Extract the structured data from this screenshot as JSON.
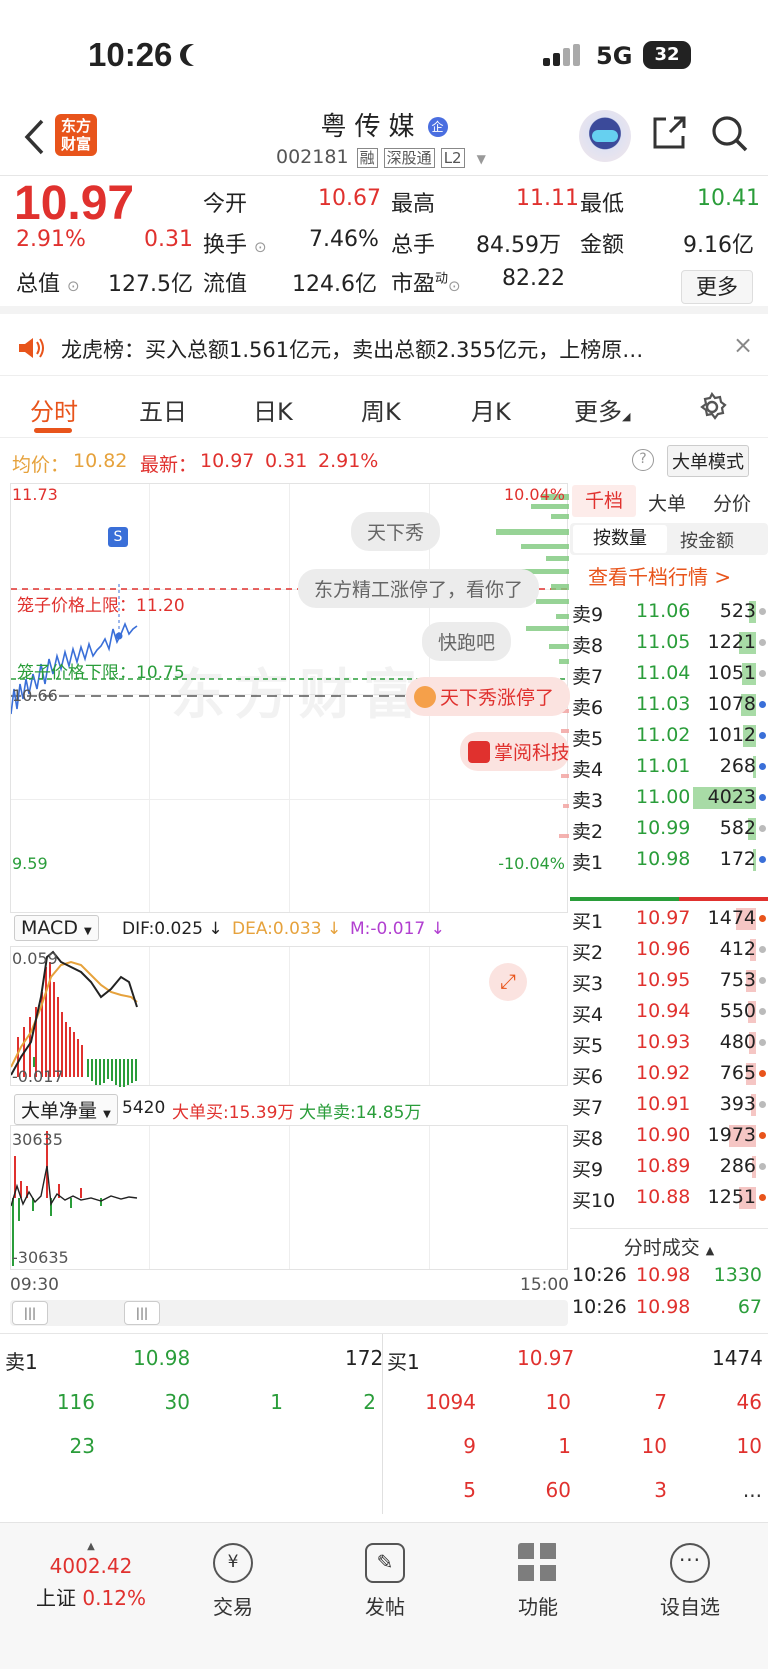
{
  "status_bar": {
    "time": "10:26",
    "network": "5G",
    "battery": "32"
  },
  "header": {
    "logo_text": "东方财富",
    "title": "粤传媒",
    "enterprise_badge": "企",
    "code": "002181",
    "tags": [
      "融",
      "深股通",
      "L2"
    ]
  },
  "quote": {
    "price": "10.97",
    "change_pct": "2.91%",
    "change": "0.31",
    "open_label": "今开",
    "open": "10.67",
    "high_label": "最高",
    "high": "11.11",
    "low_label": "最低",
    "low": "10.41",
    "turnover_label": "换手",
    "turnover": "7.46%",
    "volume_label": "总手",
    "volume": "84.59万",
    "amount_label": "金额",
    "amount": "9.16亿",
    "mcap_label": "总值",
    "mcap": "127.5亿",
    "float_label": "流值",
    "float": "124.6亿",
    "pe_label": "市盈",
    "pe_sup": "动",
    "pe": "82.22",
    "more_button": "更多"
  },
  "notice": {
    "text": "龙虎榜：买入总额1.561亿元，卖出总额2.355亿元，上榜原…"
  },
  "tabs": [
    "分时",
    "五日",
    "日K",
    "周K",
    "月K",
    "更多"
  ],
  "info_row": {
    "avg_label": "均价：",
    "avg": "10.82",
    "latest_label": "最新：",
    "latest": "10.97",
    "latest_change": "0.31",
    "latest_pct": "2.91%",
    "big_order_mode": "大单模式"
  },
  "chart": {
    "y_top": "11.73",
    "y_bottom": "9.59",
    "pct_top": "10.04%",
    "pct_bottom": "-10.04%",
    "upper_limit_label": "笼子价格上限：11.20",
    "lower_limit_label": "笼子价格下限：10.75",
    "prev_close": "10.66",
    "s_marker": "S",
    "watermark": "东方财富",
    "bubbles": [
      "天下秀",
      "东方精工涨停了，看你了",
      "快跑吧",
      "天下秀涨停了",
      "掌阅科技"
    ]
  },
  "macd": {
    "selector": "MACD",
    "dif": "DIF:0.025 ↓",
    "dea": "DEA:0.033 ↓",
    "m": "M:-0.017 ↓",
    "y_top": "0.059",
    "y_bottom": "-0.017"
  },
  "net_flow": {
    "selector": "大单净量",
    "value": "5420",
    "buy": "大单买:15.39万",
    "sell": "大单卖:14.85万",
    "y_top": "30635",
    "y_bottom": "-30635"
  },
  "time_axis": {
    "start": "09:30",
    "end": "15:00"
  },
  "order_book": {
    "tabs": [
      "千档",
      "大单",
      "分价"
    ],
    "subtabs": [
      "按数量",
      "按金额"
    ],
    "link": "查看千档行情 >",
    "asks": [
      {
        "label": "卖9",
        "price": "11.06",
        "qty": "523",
        "bar": 0.08,
        "dot": "#bbb"
      },
      {
        "label": "卖8",
        "price": "11.05",
        "qty": "1221",
        "bar": 0.2,
        "dot": "#bbb"
      },
      {
        "label": "卖7",
        "price": "11.04",
        "qty": "1051",
        "bar": 0.17,
        "dot": "#bbb"
      },
      {
        "label": "卖6",
        "price": "11.03",
        "qty": "1078",
        "bar": 0.18,
        "dot": "#3a6fd8"
      },
      {
        "label": "卖5",
        "price": "11.02",
        "qty": "1012",
        "bar": 0.16,
        "dot": "#3a6fd8"
      },
      {
        "label": "卖4",
        "price": "11.01",
        "qty": "268",
        "bar": 0.04,
        "dot": "#3a6fd8"
      },
      {
        "label": "卖3",
        "price": "11.00",
        "qty": "4023",
        "bar": 0.75,
        "dot": "#3a6fd8"
      },
      {
        "label": "卖2",
        "price": "10.99",
        "qty": "582",
        "bar": 0.09,
        "dot": "#bbb"
      },
      {
        "label": "卖1",
        "price": "10.98",
        "qty": "172",
        "bar": 0.03,
        "dot": "#3a6fd8"
      }
    ],
    "bids": [
      {
        "label": "买1",
        "price": "10.97",
        "qty": "1474",
        "bar": 0.24,
        "dot": "#e8541b"
      },
      {
        "label": "买2",
        "price": "10.96",
        "qty": "412",
        "bar": 0.07,
        "dot": "#bbb"
      },
      {
        "label": "买3",
        "price": "10.95",
        "qty": "753",
        "bar": 0.12,
        "dot": "#bbb"
      },
      {
        "label": "买4",
        "price": "10.94",
        "qty": "550",
        "bar": 0.09,
        "dot": "#bbb"
      },
      {
        "label": "买5",
        "price": "10.93",
        "qty": "480",
        "bar": 0.08,
        "dot": "#bbb"
      },
      {
        "label": "买6",
        "price": "10.92",
        "qty": "765",
        "bar": 0.12,
        "dot": "#e8541b"
      },
      {
        "label": "买7",
        "price": "10.91",
        "qty": "393",
        "bar": 0.06,
        "dot": "#bbb"
      },
      {
        "label": "买8",
        "price": "10.90",
        "qty": "1973",
        "bar": 0.32,
        "dot": "#e8541b"
      },
      {
        "label": "买9",
        "price": "10.89",
        "qty": "286",
        "bar": 0.05,
        "dot": "#bbb"
      },
      {
        "label": "买10",
        "price": "10.88",
        "qty": "1251",
        "bar": 0.2,
        "dot": "#e8541b"
      }
    ],
    "trades_header": "分时成交",
    "trades": [
      {
        "time": "10:26",
        "price": "10.98",
        "qty": "1330"
      },
      {
        "time": "10:26",
        "price": "10.98",
        "qty": "67"
      }
    ]
  },
  "queue": {
    "sell_label": "卖1",
    "sell_price": "10.98",
    "sell_total": "172",
    "buy_label": "买1",
    "buy_price": "10.97",
    "buy_total": "1474",
    "sell_rows": [
      [
        "116",
        "30",
        "1",
        "2"
      ],
      [
        "23",
        "",
        "",
        ""
      ]
    ],
    "buy_rows": [
      [
        "1094",
        "10",
        "7",
        "46"
      ],
      [
        "",
        "9",
        "1",
        "10",
        "10"
      ],
      [
        "",
        "5",
        "60",
        "3",
        "..."
      ]
    ]
  },
  "bottom_bar": {
    "index_value": "4002.42",
    "index_name": "上证",
    "index_change": "0.12%",
    "items": [
      "交易",
      "发帖",
      "功能",
      "设自选"
    ]
  }
}
